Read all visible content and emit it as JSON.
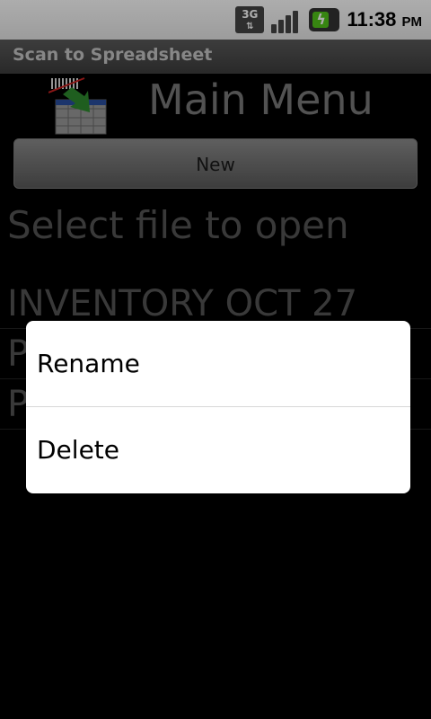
{
  "status_bar": {
    "network_badge": "3G",
    "network_icon": "3g-data-icon",
    "signal_icon": "signal-strength-icon",
    "battery_icon": "battery-charging-icon",
    "time": "11:38",
    "ampm": "PM"
  },
  "app": {
    "title": "Scan to Spreadsheet"
  },
  "header": {
    "logo_icon": "scan-spreadsheet-logo-icon",
    "title": "Main Menu"
  },
  "actions": {
    "new_label": "New"
  },
  "file_prompt": "Select file to open",
  "files": [
    {
      "label": "INVENTORY OCT 27"
    },
    {
      "label": "P"
    },
    {
      "label": "P"
    }
  ],
  "context_menu": {
    "items": [
      {
        "label": "Rename"
      },
      {
        "label": "Delete"
      }
    ]
  },
  "colors": {
    "background": "#000000",
    "dialog": "#ffffff",
    "battery": "#52c41a"
  }
}
